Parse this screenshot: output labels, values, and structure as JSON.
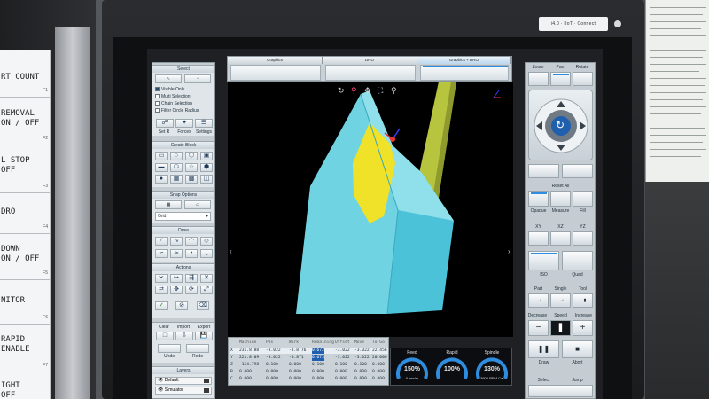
{
  "left_monitor": {
    "function_keys": [
      {
        "text": "RT COUNT",
        "tag": "F1"
      },
      {
        "text": "REMOVAL\nON / OFF",
        "tag": "F2"
      },
      {
        "text": "L STOP\nOFF",
        "tag": "F3"
      },
      {
        "text": "DRO",
        "tag": "F4"
      },
      {
        "text": "DOWN\nON / OFF",
        "tag": "F5"
      },
      {
        "text": "NITOR",
        "tag": "F6"
      },
      {
        "text": "RAPID\nENABLE",
        "tag": "F7"
      },
      {
        "text": "IGHT\nOFF",
        "tag": ""
      }
    ]
  },
  "monitor": {
    "brand": "i4.0 · IIoT · Connect"
  },
  "left_panel": {
    "select": {
      "title": "Select",
      "options": [
        "Visible Only",
        "Multi Selection",
        "Chain Selection",
        "Filter Circle Radius"
      ],
      "checked": [
        true,
        false,
        false,
        false
      ],
      "tabs": [
        "Set R",
        "Forces",
        "Settings"
      ]
    },
    "create_block": {
      "title": "Create Block"
    },
    "snap": {
      "title": "Snap Options",
      "dropdown": "Grid"
    },
    "draw": {
      "title": "Draw"
    },
    "actions": {
      "title": "Actions"
    },
    "file": {
      "buttons": [
        "Clear",
        "Import",
        "Export"
      ],
      "undo": "Undo",
      "redo": "Redo"
    },
    "layers": {
      "title": "Layers",
      "items": [
        "Default",
        "Simulator"
      ]
    }
  },
  "center": {
    "tabs": [
      "Graphics",
      "DRO",
      "Graphics + DRO"
    ],
    "active_tab": 2,
    "view_icons": [
      "rotate-icon",
      "zoom-region-icon",
      "pan-icon",
      "fit-icon",
      "zoom-icon"
    ],
    "dro": {
      "headers": [
        "",
        "Machine",
        "Pos",
        "Work",
        "Remaining",
        "Offset",
        "Move",
        "To Go"
      ],
      "rows": [
        [
          "X",
          "231.8 88",
          "-3.022",
          "-3.8 76",
          "0.672",
          "-3.022",
          "-3.022",
          "22.456"
        ],
        [
          "Y",
          "221.8 09",
          "-3.022",
          "-0.871",
          "0.673",
          "-3.022",
          "-3.022",
          "20.000"
        ],
        [
          "Z",
          "-154.798",
          "0.100",
          "0.000",
          "0.100",
          "0.100",
          "0.100",
          "0.000"
        ],
        [
          "B",
          "0.000",
          "0.000",
          "0.000",
          "0.000",
          "0.000",
          "0.000",
          "0.000"
        ],
        [
          "C",
          "0.000",
          "0.000",
          "0.000",
          "0.000",
          "0.000",
          "0.000",
          "0.000"
        ]
      ]
    },
    "gauges": [
      {
        "label": "Feed",
        "value": "150%",
        "sub": "0 mm/m",
        "percent": 150
      },
      {
        "label": "Rapid",
        "value": "100%",
        "sub": "",
        "percent": 100
      },
      {
        "label": "Spindle",
        "value": "130%",
        "sub": "3600 RPM Cw",
        "percent": 130
      }
    ]
  },
  "right_panel": {
    "view_tabs": [
      "Zoom",
      "Pan",
      "Rotate"
    ],
    "reset_all": "Reset All",
    "render_modes": [
      "Opaque",
      "Measure",
      "Fill"
    ],
    "planes": [
      "XY",
      "XZ",
      "YZ"
    ],
    "projections": [
      "ISO",
      "Quad"
    ],
    "jog_modes": [
      "Part",
      "Single",
      "Tool"
    ],
    "speed_row": [
      "Decrease",
      "Speed",
      "Increase"
    ],
    "transport": [
      "Draw",
      "Abort"
    ],
    "select_label": "Select",
    "jump_label": "Jump"
  },
  "colors": {
    "accent": "#2f8de0",
    "part_face": "#4cc2d8",
    "part_side": "#6fd3e2",
    "highlight_face": "#f0e229",
    "tool": "#b6c43e"
  }
}
